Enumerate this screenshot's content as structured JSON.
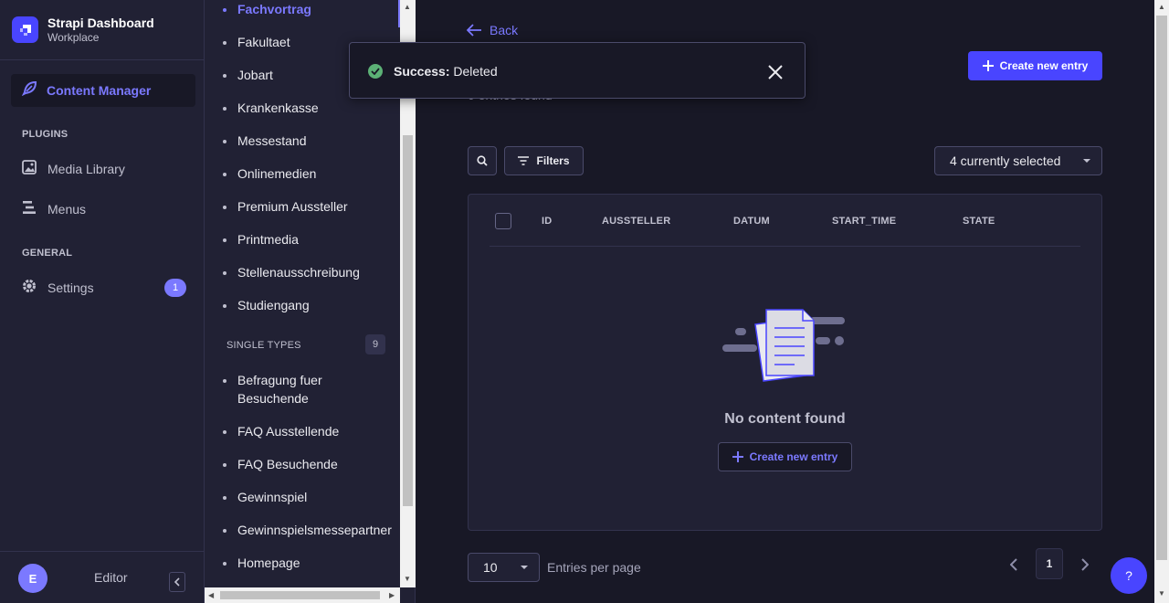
{
  "app": {
    "title": "Strapi Dashboard",
    "subtitle": "Workplace"
  },
  "mainnav": {
    "active_label": "Content Manager",
    "plugins_title": "PLUGINS",
    "media_library": "Media Library",
    "menus": "Menus",
    "general_title": "GENERAL",
    "settings": "Settings",
    "settings_badge": "1",
    "user_initial": "E",
    "user_name": "Editor"
  },
  "subnav": {
    "collection_items": [
      {
        "label": "Fachvortrag",
        "active": true
      },
      {
        "label": "Fakultaet"
      },
      {
        "label": "Jobart"
      },
      {
        "label": "Krankenkasse"
      },
      {
        "label": "Messestand"
      },
      {
        "label": "Onlinemedien"
      },
      {
        "label": "Premium Aussteller"
      },
      {
        "label": "Printmedia"
      },
      {
        "label": "Stellenausschreibung"
      },
      {
        "label": "Studiengang"
      }
    ],
    "single_types_title": "SINGLE TYPES",
    "single_types_count": "9",
    "single_items": [
      {
        "label": "Befragung fuer Besuchende"
      },
      {
        "label": "FAQ Ausstellende"
      },
      {
        "label": "FAQ Besuchende"
      },
      {
        "label": "Gewinnspiel"
      },
      {
        "label": "Gewinnspielsmessepartner"
      },
      {
        "label": "Homepage"
      }
    ]
  },
  "main": {
    "back_label": "Back",
    "entries_found": "0 entries found",
    "create_label": "Create new entry",
    "filters_label": "Filters",
    "columns_selected": "4 currently selected",
    "table_headers": [
      "ID",
      "AUSSTELLER",
      "DATUM",
      "START_TIME",
      "STATE"
    ],
    "empty_text": "No content found",
    "empty_create_label": "Create new entry",
    "per_page_value": "10",
    "per_page_label": "Entries per page",
    "current_page": "1",
    "help_label": "?"
  },
  "toast": {
    "title": "Success:",
    "message": "Deleted"
  },
  "colors": {
    "primary": "#4945ff",
    "accent": "#7b79ff",
    "success": "#5cb176",
    "bg": "#181826",
    "panel": "#212134"
  }
}
